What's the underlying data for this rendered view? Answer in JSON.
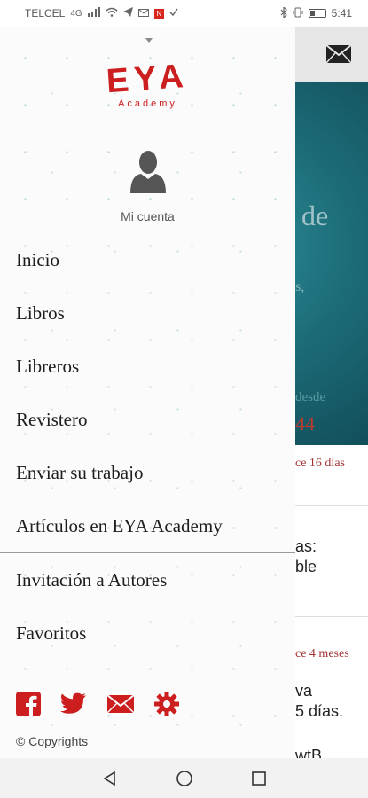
{
  "status_bar": {
    "carrier": "TELCEL",
    "carrier_extra": "4G",
    "time": "5:41",
    "icons": [
      "signal-icon",
      "wifi-icon",
      "telegram-icon",
      "mail-icon",
      "notification-icon",
      "check-icon",
      "bluetooth-icon",
      "vibrate-icon",
      "battery-icon"
    ]
  },
  "drawer": {
    "logo_main": "EYA",
    "logo_sub": "Academy",
    "account_label": "Mi cuenta",
    "menu_items": [
      {
        "label": "Inicio"
      },
      {
        "label": "Libros"
      },
      {
        "label": "Libreros"
      },
      {
        "label": "Revistero"
      },
      {
        "label": "Enviar su trabajo"
      },
      {
        "label": "Artículos en EYA Academy"
      },
      {
        "label": "Invitación a Autores"
      },
      {
        "label": "Favoritos"
      }
    ],
    "social_icons": [
      "facebook-icon",
      "twitter-icon",
      "email-icon",
      "settings-icon"
    ],
    "copyright": "© Copyrights",
    "accent_color": "#cc1e1e"
  },
  "background_app": {
    "hero_title_fragment": "de",
    "hero_sub_fragment": "s,",
    "hero_desde_fragment": "desde",
    "hero_number_fragment": "44",
    "time1": "ce 16 días",
    "text1_line1": "as:",
    "text1_line2": "ble",
    "time2": "ce 4 meses",
    "text2_line1": "va",
    "text2_line2": "5 días.",
    "text3": "wtB"
  },
  "nav_bar": {
    "buttons": [
      "back-icon",
      "home-icon",
      "recents-icon"
    ]
  }
}
